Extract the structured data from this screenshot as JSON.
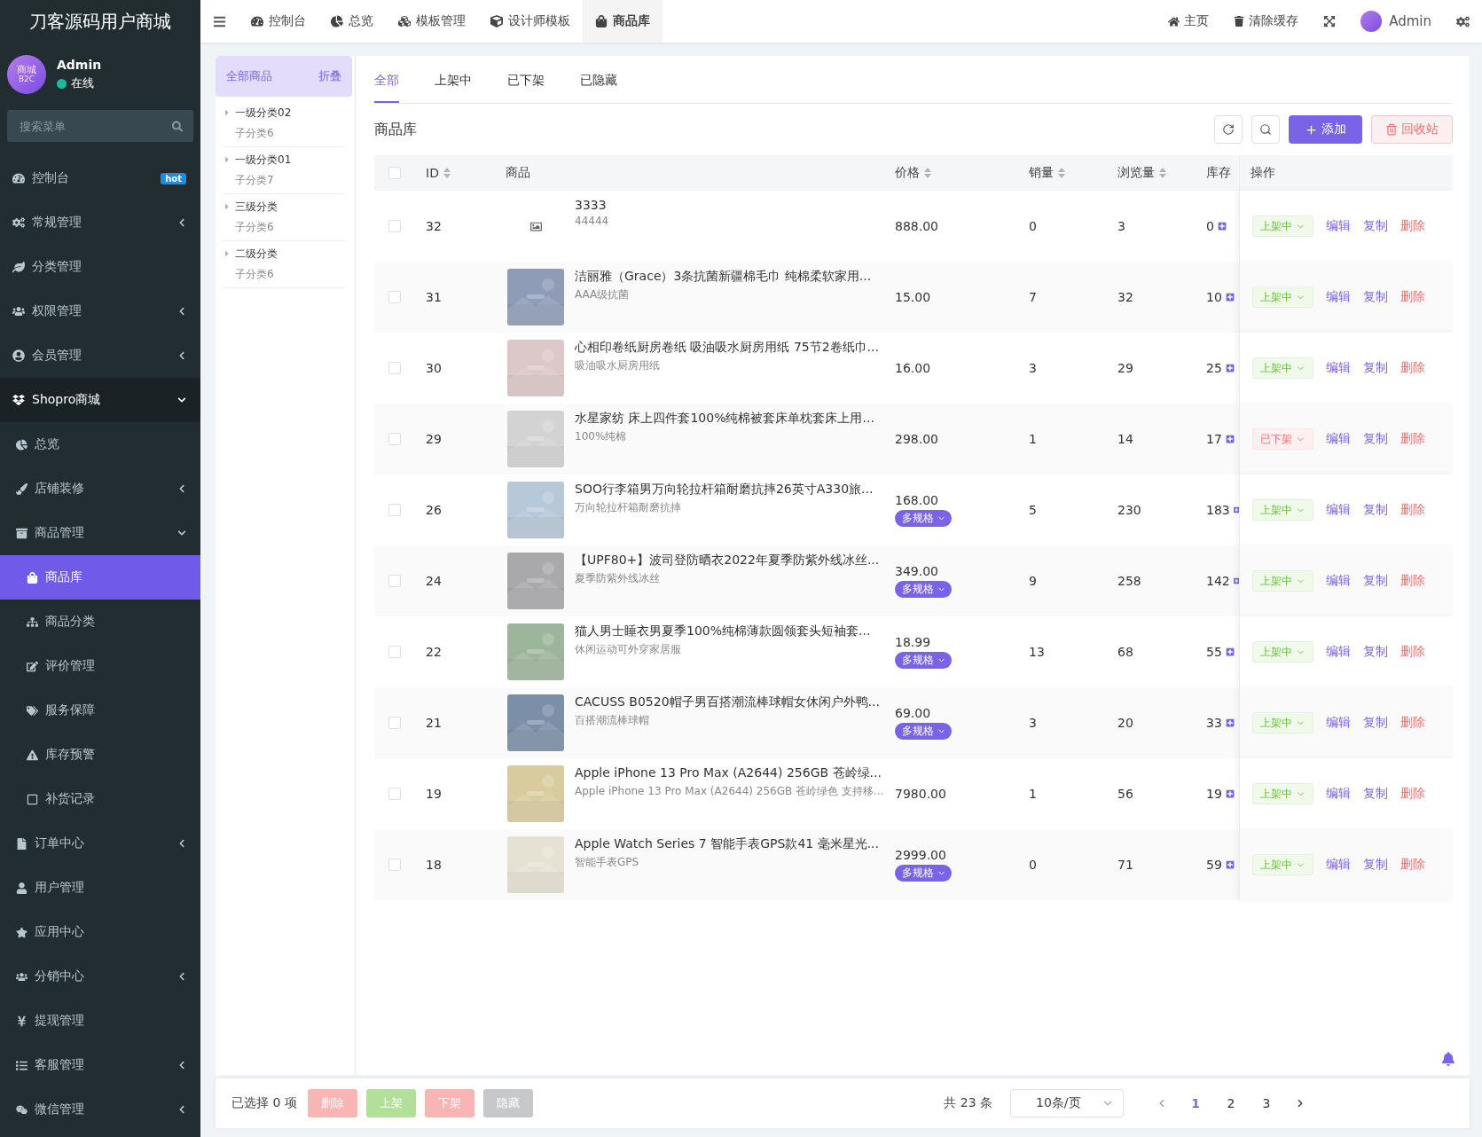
{
  "sidebar": {
    "brand": "刀客源码用户商城",
    "user": {
      "avatar_text": "商城",
      "avatar_sub": "B2C",
      "name": "Admin",
      "status": "在线",
      "online": true
    },
    "search": {
      "placeholder": "搜索菜单"
    },
    "items": [
      {
        "label": "控制台",
        "badge": "hot",
        "selected": false
      },
      {
        "label": "常规管理",
        "expanded": false,
        "selected": false
      },
      {
        "label": "分类管理",
        "selected": false
      },
      {
        "label": "权限管理",
        "expanded": false,
        "selected": false
      },
      {
        "label": "会员管理",
        "expanded": false,
        "selected": false
      },
      {
        "label": "Shopro商城",
        "expanded": true,
        "selected": false,
        "children": [
          {
            "label": "总览",
            "selected": false
          },
          {
            "label": "店铺装修",
            "expanded": false,
            "selected": false
          },
          {
            "label": "商品管理",
            "expanded": true,
            "selected": false,
            "children": [
              {
                "label": "商品库",
                "selected": true
              },
              {
                "label": "商品分类",
                "selected": false
              },
              {
                "label": "评价管理",
                "selected": false
              },
              {
                "label": "服务保障",
                "selected": false
              },
              {
                "label": "库存预警",
                "selected": false
              },
              {
                "label": "补货记录",
                "selected": false
              }
            ]
          },
          {
            "label": "订单中心",
            "expanded": false,
            "selected": false
          },
          {
            "label": "用户管理",
            "selected": false
          },
          {
            "label": "应用中心",
            "selected": false
          },
          {
            "label": "分销中心",
            "expanded": false,
            "selected": false
          },
          {
            "label": "提现管理",
            "selected": false
          },
          {
            "label": "客服管理",
            "expanded": false,
            "selected": false
          },
          {
            "label": "微信管理",
            "expanded": false,
            "selected": false
          }
        ]
      }
    ]
  },
  "topbar": {
    "tabs": [
      {
        "label": "控制台",
        "selected": false
      },
      {
        "label": "总览",
        "selected": false
      },
      {
        "label": "模板管理",
        "selected": false
      },
      {
        "label": "设计师模板",
        "selected": false
      },
      {
        "label": "商品库",
        "selected": true
      }
    ],
    "links": [
      "主页",
      "清除缓存"
    ],
    "user": "Admin"
  },
  "categories": {
    "all": "全部商品",
    "collapse": "折叠",
    "items": [
      {
        "name": "一级分类02",
        "sub": "子分类6"
      },
      {
        "name": "一级分类01",
        "sub": "子分类7"
      },
      {
        "name": "三级分类",
        "sub": "子分类6"
      },
      {
        "name": "二级分类",
        "sub": "子分类6"
      }
    ]
  },
  "tabs": [
    {
      "label": "全部",
      "selected": true
    },
    {
      "label": "上架中",
      "selected": false
    },
    {
      "label": "已下架",
      "selected": false
    },
    {
      "label": "已隐藏",
      "selected": false
    }
  ],
  "panel": {
    "title": "商品库",
    "add": "添加",
    "recycle": "回收站"
  },
  "table": {
    "all_checked": false,
    "columns": [
      {
        "label": "ID",
        "sortable": true
      },
      {
        "label": "商品",
        "sortable": false
      },
      {
        "label": "价格",
        "sortable": true
      },
      {
        "label": "销量",
        "sortable": true
      },
      {
        "label": "浏览量",
        "sortable": true
      },
      {
        "label": "库存",
        "sortable": false
      },
      {
        "label": "操作",
        "sortable": false
      }
    ],
    "rows": [
      {
        "checked": false,
        "id": "32",
        "image": false,
        "title": "3333",
        "subtitle": "44444",
        "price": "888.00",
        "sales": "0",
        "views": "3",
        "stock": "0",
        "status": {
          "label": "上架中",
          "kind": "on"
        },
        "actions": [
          "编辑",
          "复制",
          "删除"
        ]
      },
      {
        "checked": false,
        "id": "31",
        "image": true,
        "title": "洁丽雅（Grace）3条抗菌新疆棉毛巾 纯棉柔软家用...",
        "subtitle": "AAA级抗菌",
        "price": "15.00",
        "sales": "7",
        "views": "32",
        "stock": "10",
        "status": {
          "label": "上架中",
          "kind": "on"
        },
        "actions": [
          "编辑",
          "复制",
          "删除"
        ]
      },
      {
        "checked": false,
        "id": "30",
        "image": true,
        "title": "心相印卷纸厨房卷纸 吸油吸水厨房用纸 75节2卷纸巾...",
        "subtitle": "吸油吸水厨房用纸",
        "price": "16.00",
        "sales": "3",
        "views": "29",
        "stock": "25",
        "status": {
          "label": "上架中",
          "kind": "on"
        },
        "actions": [
          "编辑",
          "复制",
          "删除"
        ]
      },
      {
        "checked": false,
        "id": "29",
        "image": true,
        "title": "水星家纺 床上四件套100%纯棉被套床单枕套床上用...",
        "subtitle": "100%纯棉",
        "price": "298.00",
        "sales": "1",
        "views": "14",
        "stock": "17",
        "status": {
          "label": "已下架",
          "kind": "off"
        },
        "actions": [
          "编辑",
          "复制",
          "删除"
        ]
      },
      {
        "checked": false,
        "id": "26",
        "image": true,
        "title": "SOO行李箱男万向轮拉杆箱耐磨抗摔26英寸A330旅...",
        "subtitle": "万向轮拉杆箱耐磨抗摔",
        "price": "168.00",
        "spec": "多规格",
        "sales": "5",
        "views": "230",
        "stock": "183",
        "status": {
          "label": "上架中",
          "kind": "on"
        },
        "actions": [
          "编辑",
          "复制",
          "删除"
        ]
      },
      {
        "checked": false,
        "id": "24",
        "image": true,
        "title": "【UPF80+】波司登防晒衣2022年夏季防紫外线冰丝...",
        "subtitle": "夏季防紫外线冰丝",
        "price": "349.00",
        "spec": "多规格",
        "sales": "9",
        "views": "258",
        "stock": "142",
        "status": {
          "label": "上架中",
          "kind": "on"
        },
        "actions": [
          "编辑",
          "复制",
          "删除"
        ]
      },
      {
        "checked": false,
        "id": "22",
        "image": true,
        "title": "猫人男士睡衣男夏季100%纯棉薄款圆领套头短袖套...",
        "subtitle": "休闲运动可外穿家居服",
        "price": "18.99",
        "spec": "多规格",
        "sales": "13",
        "views": "68",
        "stock": "55",
        "status": {
          "label": "上架中",
          "kind": "on"
        },
        "actions": [
          "编辑",
          "复制",
          "删除"
        ]
      },
      {
        "checked": false,
        "id": "21",
        "image": true,
        "title": "CACUSS B0520帽子男百搭潮流棒球帽女休闲户外鸭...",
        "subtitle": "百搭潮流棒球帽",
        "price": "69.00",
        "spec": "多规格",
        "sales": "3",
        "views": "20",
        "stock": "33",
        "status": {
          "label": "上架中",
          "kind": "on"
        },
        "actions": [
          "编辑",
          "复制",
          "删除"
        ]
      },
      {
        "checked": false,
        "id": "19",
        "image": true,
        "title": "Apple iPhone 13 Pro Max (A2644) 256GB 苍岭绿...",
        "subtitle": "Apple iPhone 13 Pro Max (A2644) 256GB 苍岭绿色 支持移...",
        "price": "7980.00",
        "sales": "1",
        "views": "56",
        "stock": "19",
        "status": {
          "label": "上架中",
          "kind": "on"
        },
        "actions": [
          "编辑",
          "复制",
          "删除"
        ]
      },
      {
        "checked": false,
        "id": "18",
        "image": true,
        "title": "Apple Watch Series 7 智能手表GPS款41 毫米星光...",
        "subtitle": "智能手表GPS",
        "price": "2999.00",
        "spec": "多规格",
        "sales": "0",
        "views": "71",
        "stock": "59",
        "status": {
          "label": "上架中",
          "kind": "on"
        },
        "actions": [
          "编辑",
          "复制",
          "删除"
        ]
      }
    ]
  },
  "footer": {
    "selected": "已选择 0 项",
    "buttons": [
      {
        "label": "删除",
        "kind": "danger",
        "disabled": true
      },
      {
        "label": "上架",
        "kind": "success",
        "disabled": true
      },
      {
        "label": "下架",
        "kind": "danger",
        "disabled": true
      },
      {
        "label": "隐藏",
        "kind": "info",
        "disabled": true
      }
    ],
    "total": "共 23 条",
    "page_size": "10条/页",
    "pages": [
      {
        "label": "1",
        "selected": true
      },
      {
        "label": "2",
        "selected": false
      },
      {
        "label": "3",
        "selected": false
      }
    ]
  }
}
